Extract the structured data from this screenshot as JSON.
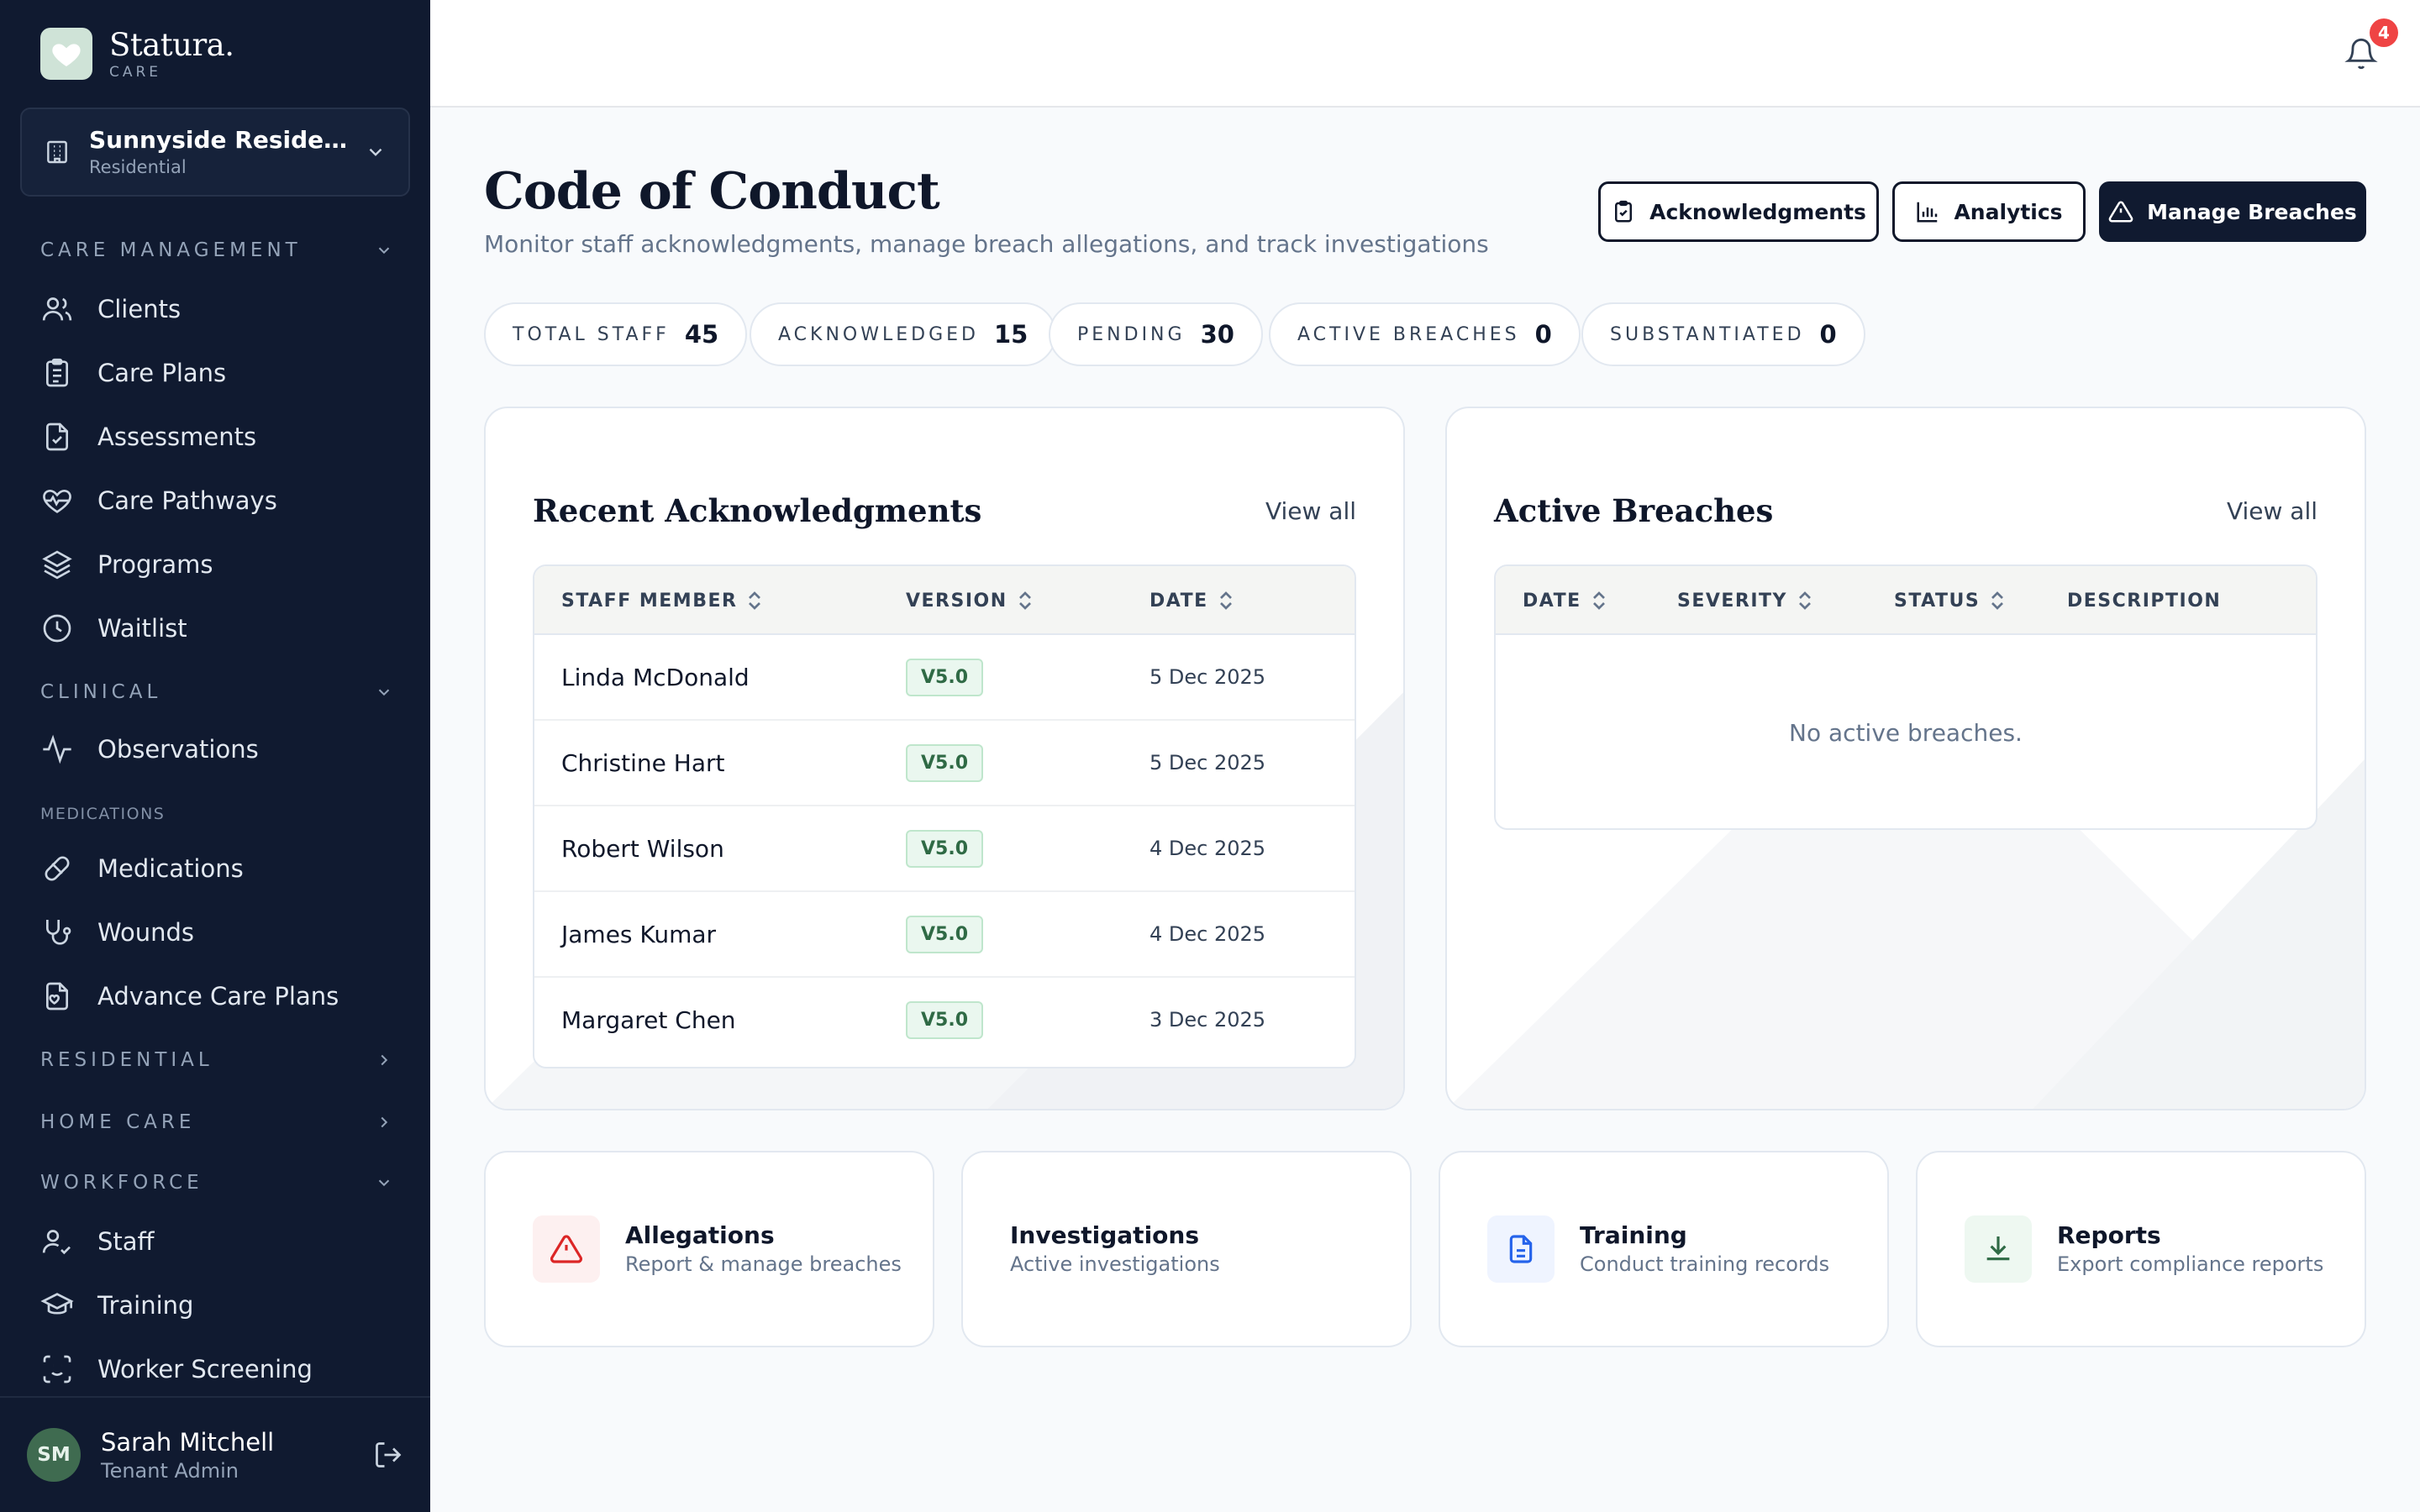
{
  "brand": {
    "name": "Statura.",
    "sub": "CARE"
  },
  "facility": {
    "name": "Sunnyside Residentia...",
    "type": "Residential"
  },
  "nav": {
    "care_management": "CARE MANAGEMENT",
    "clients": "Clients",
    "care_plans": "Care Plans",
    "assessments": "Assessments",
    "care_pathways": "Care Pathways",
    "programs": "Programs",
    "waitlist": "Waitlist",
    "clinical": "CLINICAL",
    "observations": "Observations",
    "medications_sub": "MEDICATIONS",
    "medications": "Medications",
    "wounds": "Wounds",
    "advance_care_plans": "Advance Care Plans",
    "residential": "RESIDENTIAL",
    "home_care": "HOME CARE",
    "workforce": "WORKFORCE",
    "staff": "Staff",
    "training": "Training",
    "worker_screening": "Worker Screening"
  },
  "user": {
    "initials": "SM",
    "name": "Sarah Mitchell",
    "role": "Tenant Admin"
  },
  "notifications": {
    "count": "4"
  },
  "page": {
    "title": "Code of Conduct",
    "subtitle": "Monitor staff acknowledgments, manage breach allegations, and track investigations"
  },
  "actions": {
    "acknowledgments": "Acknowledgments",
    "analytics": "Analytics",
    "manage_breaches": "Manage Breaches"
  },
  "stats": {
    "total_staff": {
      "label": "TOTAL STAFF",
      "value": "45"
    },
    "acknowledged": {
      "label": "ACKNOWLEDGED",
      "value": "15"
    },
    "pending": {
      "label": "PENDING",
      "value": "30"
    },
    "active_breaches": {
      "label": "ACTIVE BREACHES",
      "value": "0"
    },
    "substantiated": {
      "label": "SUBSTANTIATED",
      "value": "0"
    }
  },
  "recent_ack": {
    "title": "Recent Acknowledgments",
    "view_all": "View all",
    "columns": {
      "staff": "STAFF MEMBER",
      "version": "VERSION",
      "date": "DATE"
    },
    "rows": [
      {
        "name": "Linda McDonald",
        "version": "V5.0",
        "date": "5 Dec 2025"
      },
      {
        "name": "Christine Hart",
        "version": "V5.0",
        "date": "5 Dec 2025"
      },
      {
        "name": "Robert Wilson",
        "version": "V5.0",
        "date": "4 Dec 2025"
      },
      {
        "name": "James Kumar",
        "version": "V5.0",
        "date": "4 Dec 2025"
      },
      {
        "name": "Margaret Chen",
        "version": "V5.0",
        "date": "3 Dec 2025"
      }
    ]
  },
  "active_breaches": {
    "title": "Active Breaches",
    "view_all": "View all",
    "columns": {
      "date": "DATE",
      "severity": "SEVERITY",
      "status": "STATUS",
      "description": "DESCRIPTION"
    },
    "empty": "No active breaches."
  },
  "quick_links": {
    "allegations": {
      "title": "Allegations",
      "desc": "Report & manage breaches"
    },
    "investigations": {
      "title": "Investigations",
      "desc": "Active investigations"
    },
    "training": {
      "title": "Training",
      "desc": "Conduct training records"
    },
    "reports": {
      "title": "Reports",
      "desc": "Export compliance reports"
    }
  },
  "colors": {
    "sidebar": "#101a30",
    "accent_green": "#2f6a45",
    "danger": "#ef4444"
  }
}
